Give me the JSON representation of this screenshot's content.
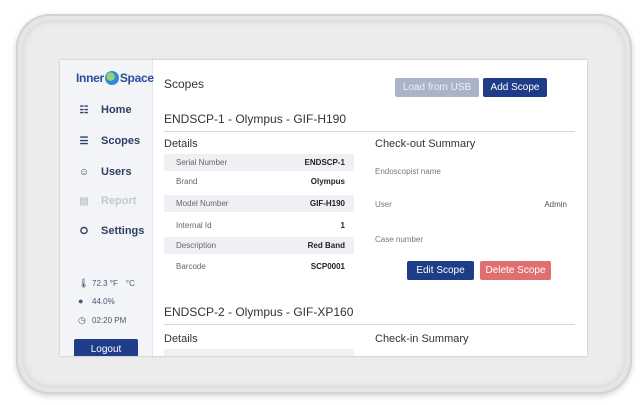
{
  "sidebar": {
    "logo": {
      "left": "Inner",
      "right": "Space"
    },
    "nav": [
      {
        "label": "Home",
        "icon": "grid-icon",
        "disabled": false
      },
      {
        "label": "Scopes",
        "icon": "list-icon",
        "disabled": false
      },
      {
        "label": "Users",
        "icon": "person-icon",
        "disabled": false
      },
      {
        "label": "Report",
        "icon": "report-icon",
        "disabled": true
      },
      {
        "label": "Settings",
        "icon": "settings-icon",
        "disabled": false
      }
    ],
    "status": {
      "temperature": "72.3 °F",
      "temp_unit": "°C",
      "humidity": "44.0%",
      "time": "02:20 PM"
    },
    "logout_label": "Logout"
  },
  "header": {
    "title": "Scopes",
    "load_usb_label": "Load from USB",
    "add_scope_label": "Add Scope"
  },
  "scopes": [
    {
      "title": "ENDSCP-1 - Olympus - GIF-H190",
      "details_heading": "Details",
      "details": [
        {
          "label": "Serial Number",
          "value": "ENDSCP-1"
        },
        {
          "label": "Brand",
          "value": "Olympus"
        },
        {
          "label": "Model Number",
          "value": "GIF-H190"
        },
        {
          "label": "Internal Id",
          "value": "1"
        },
        {
          "label": "Description",
          "value": "Red Band"
        },
        {
          "label": "Barcode",
          "value": "SCP0001"
        }
      ],
      "summary_heading": "Check-out Summary",
      "summary": {
        "endoscopist_label": "Endoscopist name",
        "user_label": "User",
        "user_value": "Admin",
        "case_label": "Case number"
      },
      "edit_label": "Edit Scope",
      "delete_label": "Delete Scope"
    },
    {
      "title": "ENDSCP-2 - Olympus - GIF-XP160",
      "details_heading": "Details",
      "summary_heading": "Check-in Summary"
    }
  ],
  "colors": {
    "primary": "#1f3c88",
    "danger": "#e07070",
    "disabled_button": "#a9b4c6",
    "sidebar_bg": "#f2f4f7"
  }
}
